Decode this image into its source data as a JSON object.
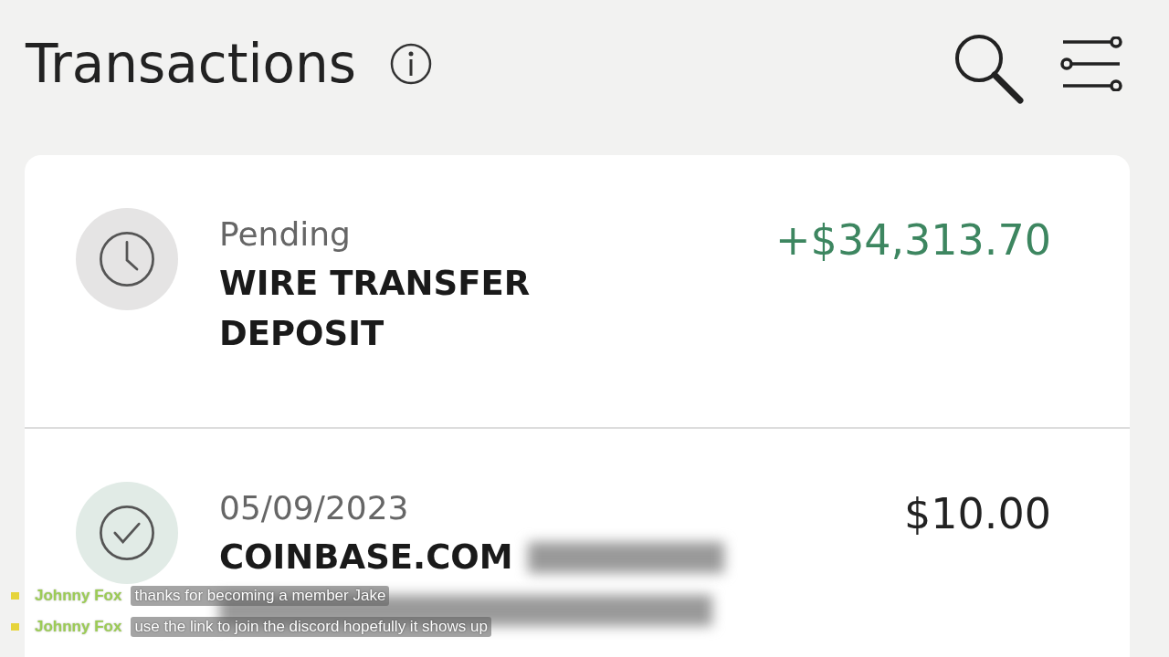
{
  "header": {
    "title": "Transactions"
  },
  "transactions": [
    {
      "kind": "pending",
      "date": "Pending",
      "description": [
        "WIRE TRANSFER",
        "DEPOSIT"
      ],
      "amount": "+$34,313.70",
      "credit": true,
      "redacted": false
    },
    {
      "kind": "posted",
      "date": "05/09/2023",
      "description": [
        "COINBASE.COM"
      ],
      "amount": "$10.00",
      "credit": false,
      "redacted": true
    }
  ],
  "chat": [
    {
      "user": "Johnny Fox",
      "message": "thanks for becoming a member Jake"
    },
    {
      "user": "Johnny Fox",
      "message": "use the link to join the discord hopefully it shows up"
    }
  ]
}
